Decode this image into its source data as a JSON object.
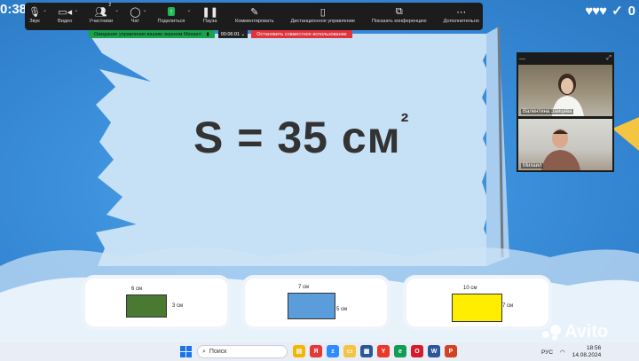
{
  "game": {
    "timer": "0:38",
    "hearts": "♥♥♥",
    "score": "0",
    "formula_main": "S = 35 см",
    "formula_exp": "²",
    "cards": [
      {
        "width_label": "6 см",
        "height_label": "3 см",
        "color": "#4a7a32"
      },
      {
        "width_label": "7 см",
        "height_label": "5 см",
        "color": "#5b9ddb"
      },
      {
        "width_label": "10 см",
        "height_label": "7 см",
        "color": "#ffee00"
      }
    ]
  },
  "toolbar": {
    "items": [
      {
        "label": "Звук",
        "icon": "microphone-icon"
      },
      {
        "label": "Видео",
        "icon": "camera-icon"
      },
      {
        "label": "Участники",
        "icon": "participants-icon",
        "badge": "2"
      },
      {
        "label": "Чат",
        "icon": "chat-icon"
      },
      {
        "label": "Поделиться",
        "icon": "share-icon"
      },
      {
        "label": "Пауза",
        "icon": "pause-icon"
      },
      {
        "label": "Комментировать",
        "icon": "pen-icon"
      },
      {
        "label": "Дистанционное управление",
        "icon": "mouse-icon"
      },
      {
        "label": "Показать конференцию",
        "icon": "window-icon"
      },
      {
        "label": "Дополнительно",
        "icon": "more-icon"
      }
    ]
  },
  "share_status": {
    "waiting_text": "Ожидание управления вашим экраном Михаил",
    "elapsed": "00:06:01",
    "stop_text": "Остановить совместное использование"
  },
  "video": {
    "participants": [
      {
        "name": "Валентина Зайцева"
      },
      {
        "name": "Михаил"
      }
    ]
  },
  "taskbar": {
    "search_placeholder": "Поиск",
    "lang": "РУС",
    "time": "18:56",
    "date": "14.08.2024",
    "apps": [
      {
        "icon": "explorer-icon",
        "color": "#f2b705",
        "glyph": "▤"
      },
      {
        "icon": "yandex-icon",
        "color": "#e53935",
        "glyph": "Я"
      },
      {
        "icon": "zoom-icon",
        "color": "#2d8cff",
        "glyph": "z"
      },
      {
        "icon": "folder-icon",
        "color": "#f4c542",
        "glyph": "▭"
      },
      {
        "icon": "calendar-icon",
        "color": "#2b5797",
        "glyph": "▦"
      },
      {
        "icon": "yandex-browser-icon",
        "color": "#e8392c",
        "glyph": "Y"
      },
      {
        "icon": "edge-icon",
        "color": "#0f9d58",
        "glyph": "e"
      },
      {
        "icon": "opera-icon",
        "color": "#d81b2a",
        "glyph": "O"
      },
      {
        "icon": "word-icon",
        "color": "#2b579a",
        "glyph": "W"
      },
      {
        "icon": "powerpoint-icon",
        "color": "#d04423",
        "glyph": "P"
      }
    ]
  },
  "watermark": "Avito"
}
